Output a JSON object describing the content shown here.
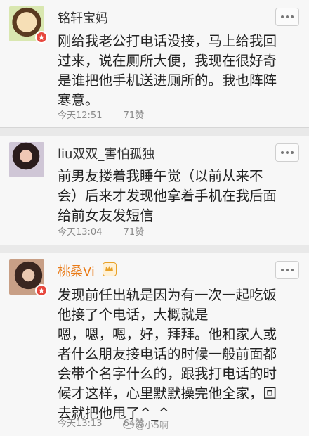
{
  "comments": [
    {
      "username": "铭轩宝妈",
      "content": "刚给我老公打电话没接，马上给我回\n过来，说在厕所大便，我现在很好奇\n是谁把他手机送进厕所的。我也阵阵\n寒意。",
      "time": "今天12:51",
      "likes": "71赞",
      "verified_icon": "verified-badge-icon"
    },
    {
      "username": "liu双双_害怕孤独",
      "content": "前男友搂着我睡午觉（以前从来不\n会）后来才发现他拿着手机在我后面\n给前女友发短信",
      "time": "今天13:04",
      "likes": "71赞"
    },
    {
      "username": "桃桑Vi",
      "content": "发现前任出轨是因为有一次一起吃饭\n他接了个电话，大概就是\n嗯，嗯，嗯，好，拜拜。他和家人或\n者什么朋友接电话的时候一般前面都\n会带个名字什么的，跟我打电话的时\n候才这样，心里默默操完他全家，回\n去就把他甩了^_^",
      "time": "今天13:13",
      "likes": "64赞",
      "verified_icon": "verified-badge-icon",
      "member_icon": "vip-member-icon"
    }
  ],
  "watermark": "@小5啊",
  "colors": {
    "username_highlight": "#e97b18",
    "badge": "#e7473d"
  }
}
